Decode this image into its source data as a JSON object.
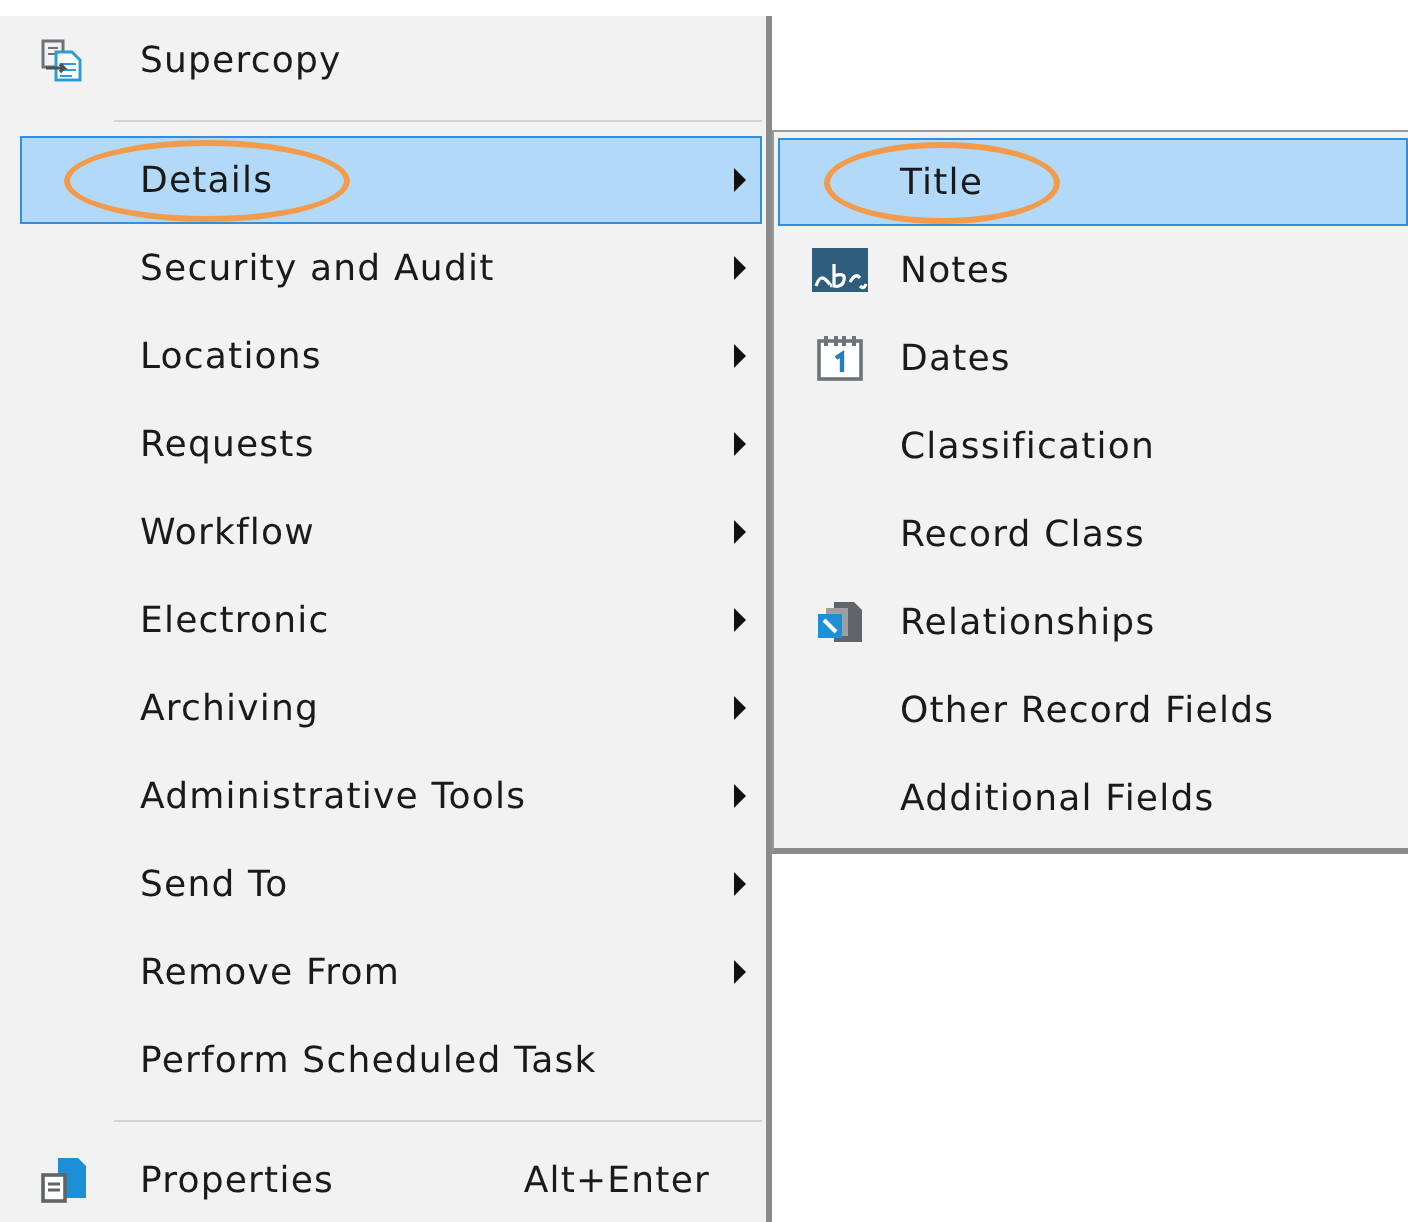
{
  "menu": {
    "items": [
      {
        "kind": "copy",
        "label": "Supercopy",
        "selected": false,
        "submenu": false,
        "annotated": false
      },
      {
        "kind": "separator"
      },
      {
        "kind": "plain",
        "label": "Details",
        "selected": true,
        "submenu": true,
        "annotated": true
      },
      {
        "kind": "plain",
        "label": "Security and Audit",
        "selected": false,
        "submenu": true,
        "annotated": false
      },
      {
        "kind": "plain",
        "label": "Locations",
        "selected": false,
        "submenu": true,
        "annotated": false
      },
      {
        "kind": "plain",
        "label": "Requests",
        "selected": false,
        "submenu": true,
        "annotated": false
      },
      {
        "kind": "plain",
        "label": "Workflow",
        "selected": false,
        "submenu": true,
        "annotated": false
      },
      {
        "kind": "plain",
        "label": "Electronic",
        "selected": false,
        "submenu": true,
        "annotated": false
      },
      {
        "kind": "plain",
        "label": "Archiving",
        "selected": false,
        "submenu": true,
        "annotated": false
      },
      {
        "kind": "plain",
        "label": "Administrative Tools",
        "selected": false,
        "submenu": true,
        "annotated": false
      },
      {
        "kind": "plain",
        "label": "Send To",
        "selected": false,
        "submenu": true,
        "annotated": false
      },
      {
        "kind": "plain",
        "label": "Remove From",
        "selected": false,
        "submenu": true,
        "annotated": false
      },
      {
        "kind": "plain",
        "label": "Perform Scheduled Task",
        "selected": false,
        "submenu": false,
        "annotated": false
      },
      {
        "kind": "separator"
      },
      {
        "kind": "properties",
        "label": "Properties",
        "shortcut": "Alt+Enter",
        "selected": false,
        "submenu": false,
        "annotated": false
      }
    ]
  },
  "submenu": {
    "items": [
      {
        "kind": "plain",
        "label": "Title",
        "selected": true,
        "submenu": false,
        "annotated": true
      },
      {
        "kind": "notes",
        "label": "Notes",
        "selected": false,
        "submenu": false,
        "annotated": false
      },
      {
        "kind": "calendar",
        "label": "Dates",
        "selected": false,
        "submenu": false,
        "annotated": false
      },
      {
        "kind": "plain",
        "label": "Classification",
        "selected": false,
        "submenu": false,
        "annotated": false
      },
      {
        "kind": "plain",
        "label": "Record Class",
        "selected": false,
        "submenu": false,
        "annotated": false
      },
      {
        "kind": "relations",
        "label": "Relationships",
        "selected": false,
        "submenu": false,
        "annotated": false
      },
      {
        "kind": "plain",
        "label": "Other Record Fields",
        "selected": false,
        "submenu": false,
        "annotated": false
      },
      {
        "kind": "plain",
        "label": "Additional Fields",
        "selected": false,
        "submenu": false,
        "annotated": false
      }
    ]
  }
}
